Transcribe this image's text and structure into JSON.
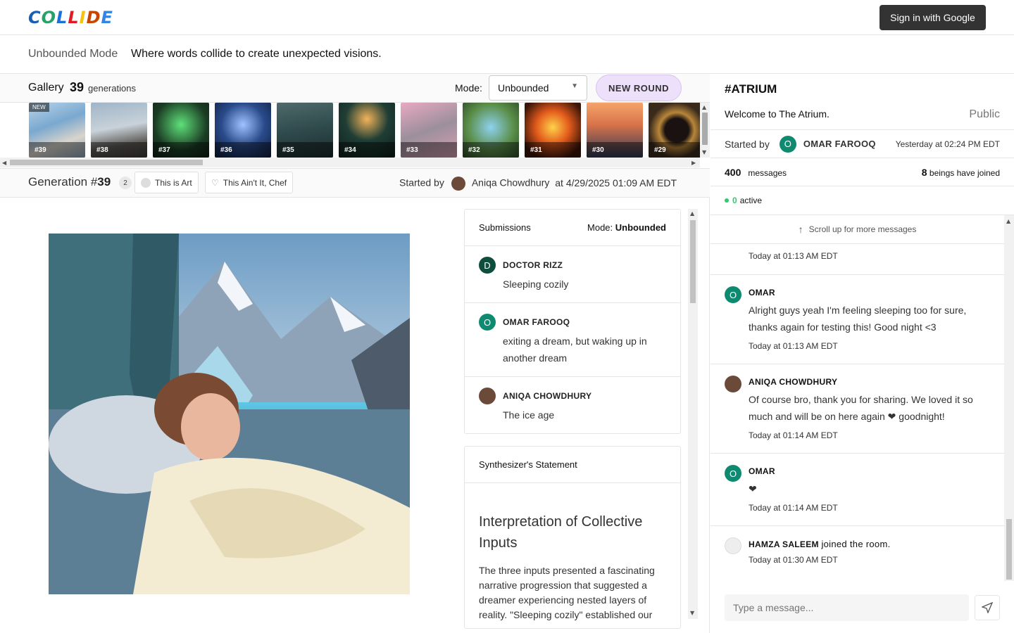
{
  "header": {
    "logo": "COLLIDE",
    "signin_label": "Sign in with Google"
  },
  "modebar": {
    "mode": "Unbounded Mode",
    "tagline": "Where words collide to create unexpected visions."
  },
  "gallery": {
    "title": "Gallery",
    "count": "39",
    "count_label": "generations",
    "mode_label": "Mode:",
    "mode_value": "Unbounded",
    "new_round": "NEW ROUND",
    "new_badge": "NEW",
    "thumbs": [
      "#39",
      "#38",
      "#37",
      "#36",
      "#35",
      "#34",
      "#33",
      "#32",
      "#31",
      "#30",
      "#29"
    ]
  },
  "generation": {
    "title_prefix": "Generation #",
    "number": "39",
    "votes": "2",
    "art_label": "This is Art",
    "chef_label": "This Ain't It, Chef",
    "started_by": "Started by",
    "author": "Aniqa Chowdhury",
    "at": "at 4/29/2025 01:09 AM EDT"
  },
  "submissions": {
    "title": "Submissions",
    "mode_label": "Mode:",
    "mode_value": "Unbounded",
    "items": [
      {
        "initial": "D",
        "name": "DOCTOR RIZZ",
        "text": "Sleeping cozily",
        "color": "#0f4d3c"
      },
      {
        "initial": "O",
        "name": "OMAR FAROOQ",
        "text": "exiting a dream, but waking up in another dream",
        "color": "#0d8a6f"
      },
      {
        "initial": "",
        "name": "ANIQA CHOWDHURY",
        "text": "The ice age",
        "color": "#6b4a3a"
      }
    ]
  },
  "synth": {
    "title": "Synthesizer's Statement",
    "heading": "Interpretation of Collective Inputs",
    "body": "The three inputs presented a fascinating narrative progression that suggested a dreamer experiencing nested layers of reality. \"Sleeping cozily\" established our"
  },
  "room": {
    "name": "#ATRIUM",
    "welcome": "Welcome to The Atrium.",
    "visibility": "Public",
    "started_by": "Started by",
    "starter_initial": "O",
    "starter": "OMAR FAROOQ",
    "started_at": "Yesterday at 02:24 PM EDT",
    "messages_count": "400",
    "messages_label": "messages",
    "beings_count": "8",
    "beings_label": "beings have joined",
    "active_count": "0",
    "active_label": "active",
    "scroll_up": "Scroll up for more messages"
  },
  "chat": {
    "first_ts": "Today at 01:13 AM EDT",
    "messages": [
      {
        "initial": "O",
        "name": "OMAR",
        "text": "Alright guys yeah I'm feeling sleeping too for sure, thanks again for testing this! Good night <3",
        "ts": "Today at 01:13 AM EDT",
        "color": "#0d8a6f"
      },
      {
        "initial": "",
        "name": "ANIQA CHOWDHURY",
        "text": "Of course bro, thank you for sharing. We loved it so much and will be on here again ❤ goodnight!",
        "ts": "Today at 01:14 AM EDT",
        "color": "#6b4a3a"
      },
      {
        "initial": "O",
        "name": "OMAR",
        "text": "❤",
        "ts": "Today at 01:14 AM EDT",
        "color": "#0d8a6f"
      }
    ],
    "join": {
      "name": "HAMZA SALEEM",
      "text": "joined the room.",
      "ts": "Today at 01:30 AM EDT"
    },
    "input_placeholder": "Type a message..."
  }
}
